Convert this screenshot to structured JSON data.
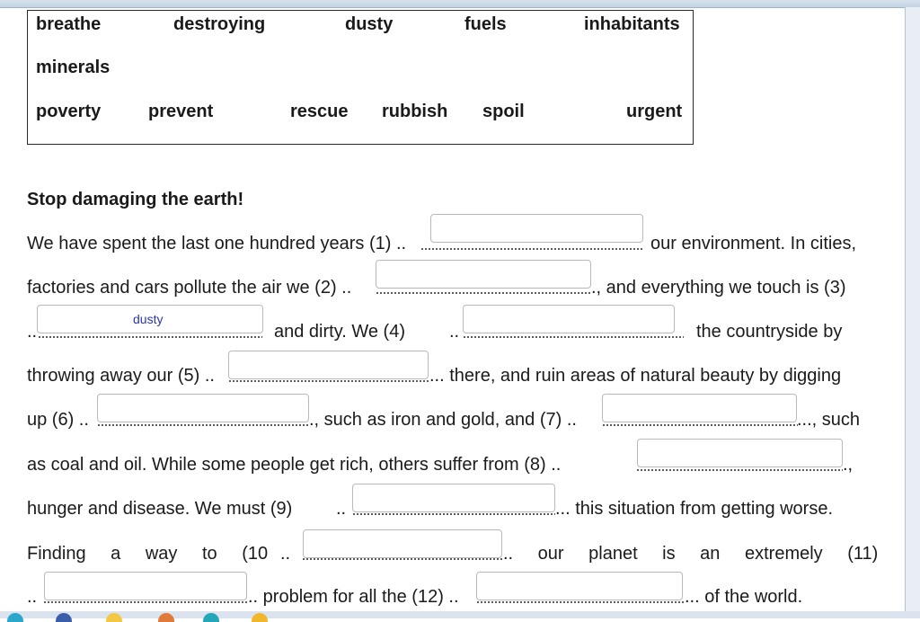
{
  "word_bank": {
    "words": [
      "breathe",
      "destroying",
      "dusty",
      "fuels",
      "inhabitants",
      "minerals",
      "poverty",
      "prevent",
      "rescue",
      "rubbish",
      "spoil",
      "urgent"
    ]
  },
  "passage": {
    "title": "Stop damaging the earth!",
    "segments": [
      "We have spent the last one hundred years (1) ..",
      "our environment. In cities,",
      "factories and cars pollute the air we (2) ..",
      "., and everything we touch is (3)",
      "..",
      "and dirty. We (4)",
      "..",
      "the countryside by",
      "throwing away our (5) ..",
      "... there, and ruin areas of natural beauty by digging",
      "up (6) ..",
      "., such as iron and gold, and (7) ..",
      "..., such",
      "as coal and oil. While some people get rich, others suffer from (8) ..",
      ".,",
      "hunger and disease. We must (9)",
      "..",
      "... this situation from getting worse.",
      "Finding a way to (10",
      "..",
      ".. our planet is an extremely (11)",
      "..",
      ".. problem for all the (12) ..",
      "... of the world."
    ],
    "answers": [
      "",
      "",
      "dusty",
      "",
      "",
      "",
      "",
      "",
      "",
      "",
      "",
      ""
    ]
  }
}
